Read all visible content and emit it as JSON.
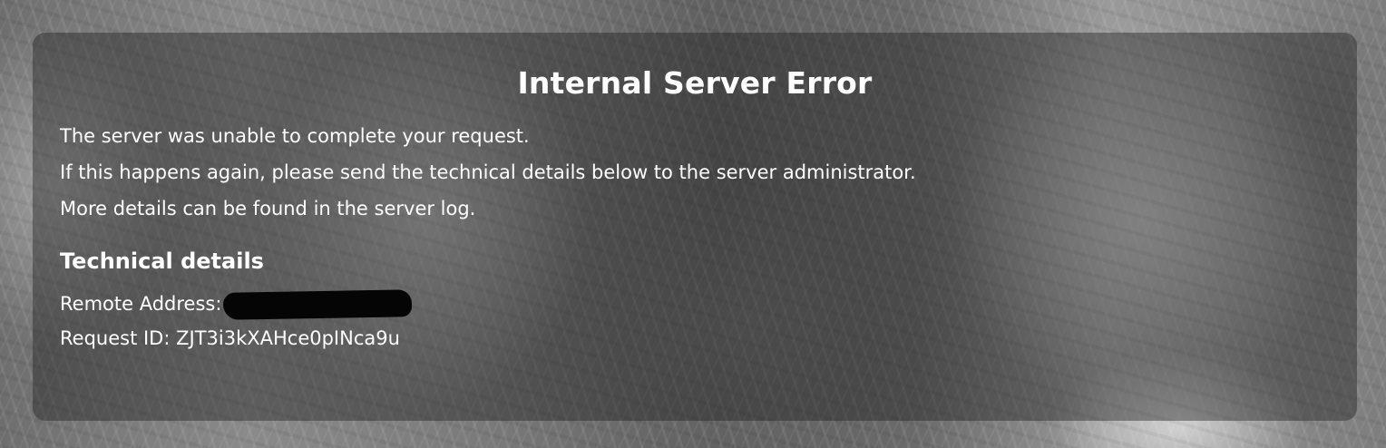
{
  "error": {
    "title": "Internal Server Error",
    "messages": [
      "The server was unable to complete your request.",
      "If this happens again, please send the technical details below to the server administrator.",
      "More details can be found in the server log."
    ],
    "technical_details": {
      "heading": "Technical details",
      "remote_address_label": "Remote Address:",
      "request_id_label": "Request ID:",
      "request_id_value": "ZJT3i3kXAHce0pINca9u"
    }
  }
}
